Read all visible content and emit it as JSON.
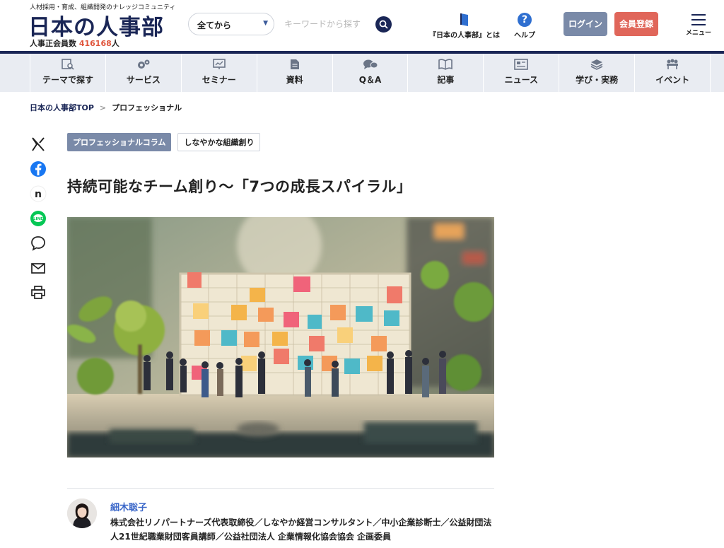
{
  "header": {
    "tagline": "人材採用・育成、組織開発のナレッジコミュニティ",
    "logo": "日本の人事部",
    "members_label": "人事正会員数",
    "members_count": "416168",
    "members_unit": "人",
    "search_scope": "全てから",
    "search_placeholder": "キーワードから探す",
    "about_label": "『日本の人事部』とは",
    "help_label": "ヘルプ",
    "login_label": "ログイン",
    "signup_label": "会員登録",
    "menu_label": "メニュー"
  },
  "nav": {
    "items": [
      {
        "label": "テーマで探す",
        "icon": "search-doc-icon"
      },
      {
        "label": "サービス",
        "icon": "gears-icon"
      },
      {
        "label": "セミナー",
        "icon": "presentation-icon"
      },
      {
        "label": "資料",
        "icon": "document-icon"
      },
      {
        "label": "Q＆A",
        "icon": "chat-bubbles-icon"
      },
      {
        "label": "記事",
        "icon": "book-icon"
      },
      {
        "label": "ニュース",
        "icon": "newspaper-icon"
      },
      {
        "label": "学び・実務",
        "icon": "books-stack-icon"
      },
      {
        "label": "イベント",
        "icon": "people-icon"
      }
    ]
  },
  "breadcrumb": {
    "home": "日本の人事部TOP",
    "separator": ">",
    "current": "プロフェッショナル"
  },
  "share": [
    "x-icon",
    "facebook-icon",
    "note-icon",
    "line-icon",
    "comment-icon",
    "mail-icon",
    "print-icon"
  ],
  "article": {
    "tag_primary": "プロフェッショナルコラム",
    "tag_secondary": "しなやかな組織創り",
    "title": "持続可能なチーム創り〜「7つの成長スパイラル」"
  },
  "author": {
    "name": "細木聡子",
    "bio": "株式会社リノパートナーズ代表取締役／しなやか経営コンサルタント／中小企業診断士／公益財団法人21世紀職業財団客員講師／公益社団法人 企業情報化協会協会 企画委員"
  },
  "colors": {
    "brand_navy": "#1a2656",
    "accent_red": "#e0553c",
    "login_bg": "#7a8aa8",
    "signup_bg": "#e0665a",
    "nav_bg": "#e9ecf2",
    "author_link": "#3c68c9"
  }
}
